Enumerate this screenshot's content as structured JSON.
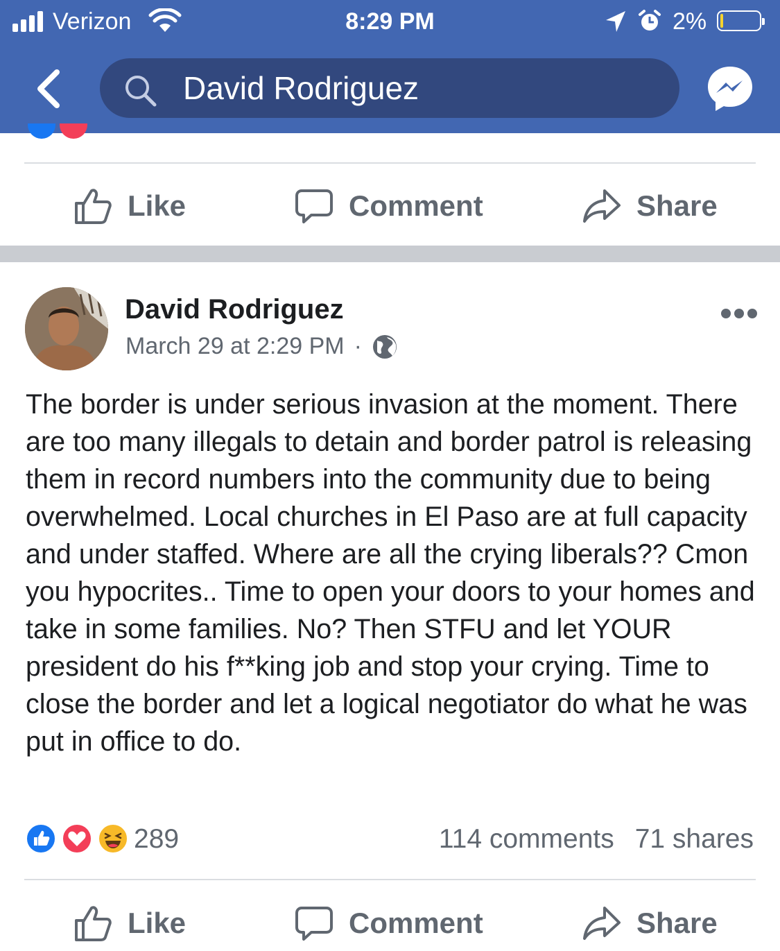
{
  "status_bar": {
    "carrier": "Verizon",
    "time": "8:29 PM",
    "battery": "2%"
  },
  "nav": {
    "search_text": "David Rodriguez"
  },
  "actions": {
    "like": "Like",
    "comment": "Comment",
    "share": "Share"
  },
  "post": {
    "author": "David Rodriguez",
    "timestamp": "March 29 at 2:29 PM",
    "separator": "·",
    "body": "The border is under serious invasion at the moment. There are too many illegals to detain and border patrol is releasing them in record numbers into the community due to being overwhelmed. Local churches in El Paso are at full capacity and under staffed. Where are all the crying liberals?? Cmon you hypocrites.. Time to open your doors to your homes and take in some families. No? Then STFU and let YOUR president do his f**king job and stop your crying. Time to close the border and let a logical negotiator do what he was put in office to do.",
    "reaction_count": "289",
    "comments": "114 comments",
    "shares": "71 shares",
    "reactions": [
      "like-icon",
      "love-icon",
      "haha-icon"
    ]
  },
  "colors": {
    "brand": "#4267b2",
    "search_bg": "#32487e",
    "muted_text": "#606770",
    "like_blue": "#1877f2",
    "love_red": "#f33e58",
    "haha_yellow": "#f7b928"
  }
}
